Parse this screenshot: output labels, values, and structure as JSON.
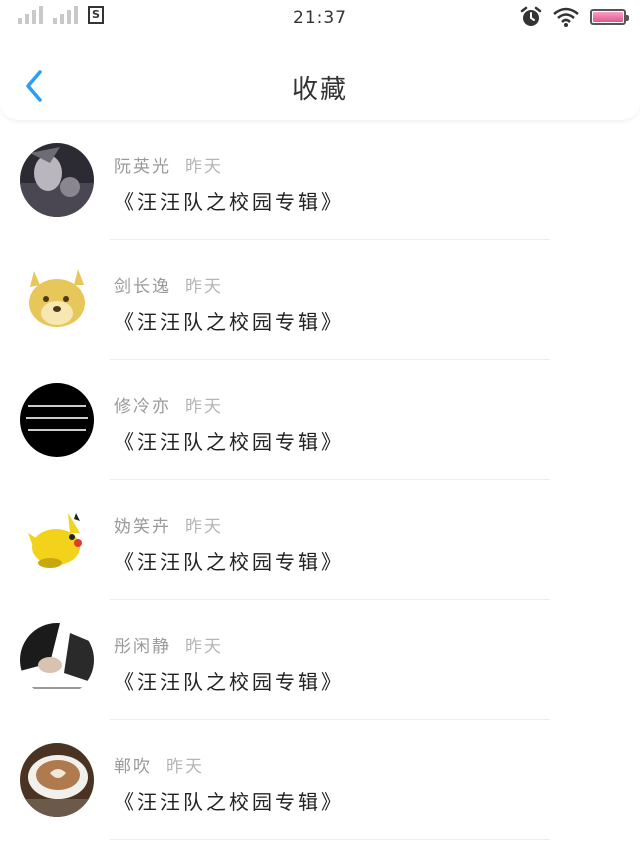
{
  "status_bar": {
    "time": "21:37",
    "sim_label": "S",
    "icons": [
      "signal-icon",
      "signal-icon",
      "sim-icon",
      "alarm-icon",
      "wifi-icon",
      "battery-icon"
    ],
    "battery_color": "#e2558f"
  },
  "header": {
    "title": "收藏",
    "back_icon": "chevron-left-icon",
    "accent": "#2a9df4"
  },
  "favorites": [
    {
      "name": "阮英光",
      "time": "昨天",
      "album": "《汪汪队之校园专辑》",
      "avatar": "dark-photo-avatar"
    },
    {
      "name": "剑长逸",
      "time": "昨天",
      "album": "《汪汪队之校园专辑》",
      "avatar": "doge-avatar"
    },
    {
      "name": "修冷亦",
      "time": "昨天",
      "album": "《汪汪队之校园专辑》",
      "avatar": "text-on-black-avatar"
    },
    {
      "name": "妫笑卉",
      "time": "昨天",
      "album": "《汪汪队之校园专辑》",
      "avatar": "pikachu-avatar"
    },
    {
      "name": "彤闲静",
      "time": "昨天",
      "album": "《汪汪队之校园专辑》",
      "avatar": "hand-photo-avatar"
    },
    {
      "name": "郸吹",
      "time": "昨天",
      "album": "《汪汪队之校园专辑》",
      "avatar": "coffee-avatar"
    }
  ]
}
